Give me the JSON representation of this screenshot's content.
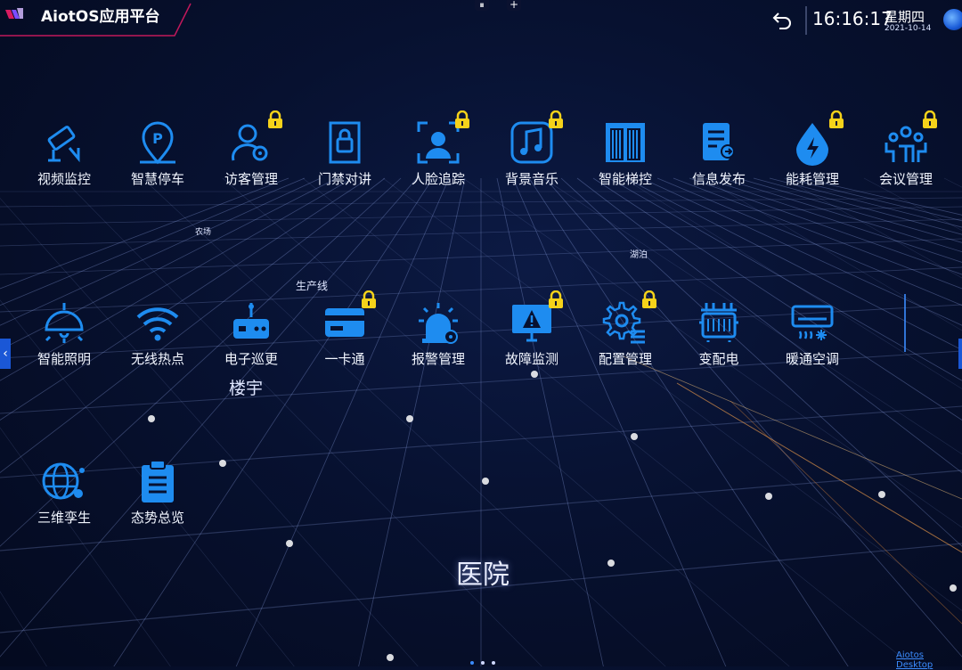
{
  "header": {
    "app_title": "AiotOS应用平台",
    "pause_label": "⏸",
    "add_label": "+",
    "time": "16:16:17",
    "weekday": "星期四",
    "date": "2021-10-14"
  },
  "apps": [
    {
      "label": "视频监控",
      "icon": "camera-icon",
      "locked": false
    },
    {
      "label": "智慧停车",
      "icon": "parking-icon",
      "locked": false
    },
    {
      "label": "访客管理",
      "icon": "visitor-icon",
      "locked": true
    },
    {
      "label": "门禁对讲",
      "icon": "door-intercom-icon",
      "locked": false
    },
    {
      "label": "人脸追踪",
      "icon": "face-tracking-icon",
      "locked": true
    },
    {
      "label": "背景音乐",
      "icon": "music-icon",
      "locked": true
    },
    {
      "label": "智能梯控",
      "icon": "elevator-icon",
      "locked": false
    },
    {
      "label": "信息发布",
      "icon": "info-publish-icon",
      "locked": false
    },
    {
      "label": "能耗管理",
      "icon": "energy-icon",
      "locked": true
    },
    {
      "label": "会议管理",
      "icon": "meeting-icon",
      "locked": true
    },
    {
      "label": "智能照明",
      "icon": "lighting-icon",
      "locked": false
    },
    {
      "label": "无线热点",
      "icon": "wifi-icon",
      "locked": false
    },
    {
      "label": "电子巡更",
      "icon": "patrol-icon",
      "locked": false
    },
    {
      "label": "一卡通",
      "icon": "card-icon",
      "locked": true
    },
    {
      "label": "报警管理",
      "icon": "alarm-icon",
      "locked": false
    },
    {
      "label": "故障监测",
      "icon": "fault-monitor-icon",
      "locked": true
    },
    {
      "label": "配置管理",
      "icon": "config-icon",
      "locked": true
    },
    {
      "label": "变配电",
      "icon": "power-distribution-icon",
      "locked": false
    },
    {
      "label": "暖通空调",
      "icon": "hvac-icon",
      "locked": false
    },
    {
      "label": "三维孪生",
      "icon": "digital-twin-icon",
      "locked": false
    },
    {
      "label": "态势总览",
      "icon": "clipboard-icon",
      "locked": false
    }
  ],
  "map_labels": {
    "farm": "农场",
    "lake": "湖泊",
    "production_line": "生产线",
    "building": "楼宇",
    "hospital": "医院"
  },
  "pager": {
    "pages": 3,
    "current": 1
  },
  "footer_link": "Aiotos Desktop",
  "colors": {
    "accent": "#1e8cf0",
    "lock": "#f5d21a",
    "title_bar_edge": "#c2185b"
  }
}
